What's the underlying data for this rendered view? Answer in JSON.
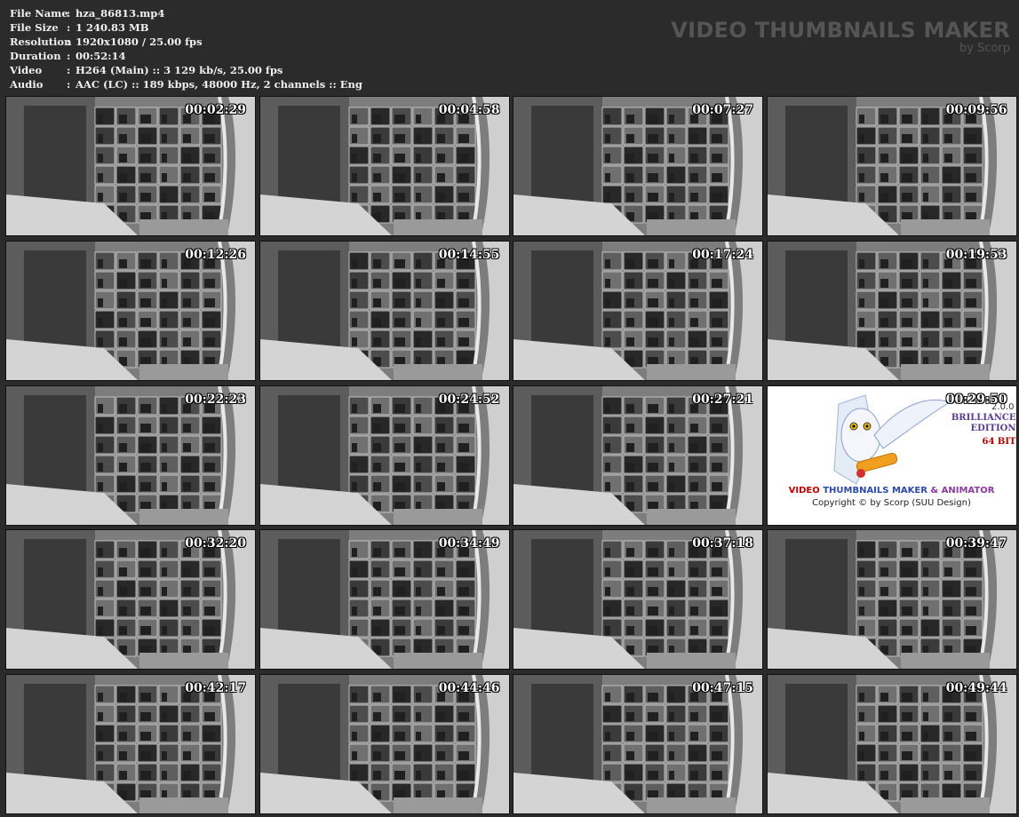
{
  "info": [
    {
      "label": "File Name",
      "sep": ":",
      "value": "hza_86813.mp4"
    },
    {
      "label": "File Size",
      "sep": ":",
      "value": "1 240.83 MB"
    },
    {
      "label": "Resolution",
      "sep": ":",
      "value": "1920x1080 / 25.00 fps"
    },
    {
      "label": "Duration",
      "sep": ":",
      "value": "00:52:14"
    },
    {
      "label": "Video",
      "sep": ":",
      "value": "H264 (Main) :: 3 129 kb/s, 25.00 fps"
    },
    {
      "label": "Audio",
      "sep": ":",
      "value": "AAC (LC) :: 189 kbps, 48000 Hz, 2 channels :: Eng"
    }
  ],
  "brand": {
    "title": "VIDEO THUMBNAILS MAKER",
    "subtitle": "by Scorp"
  },
  "thumbnails": [
    {
      "time": "00:02:29"
    },
    {
      "time": "00:04:58"
    },
    {
      "time": "00:07:27"
    },
    {
      "time": "00:09:56"
    },
    {
      "time": "00:12:26"
    },
    {
      "time": "00:14:55"
    },
    {
      "time": "00:17:24"
    },
    {
      "time": "00:19:53"
    },
    {
      "time": "00:22:23"
    },
    {
      "time": "00:24:52"
    },
    {
      "time": "00:27:21"
    },
    {
      "time": "00:29:50"
    },
    {
      "time": "00:32:20"
    },
    {
      "time": "00:34:49"
    },
    {
      "time": "00:37:18"
    },
    {
      "time": "00:39:47"
    },
    {
      "time": "00:42:17"
    },
    {
      "time": "00:44:46"
    },
    {
      "time": "00:47:15"
    },
    {
      "time": "00:49:44"
    }
  ],
  "logo_tile": {
    "version": "2.0.0",
    "edition_line1": "BRILLIANCE",
    "edition_line2": "EDITION",
    "edition_line3": "64 BIT",
    "title_part1": "VIDEO",
    "title_part2": "THUMBNAILS MAKER",
    "title_part3": "& ANIMATOR",
    "copyright": "Copyright © by Scorp (SUU Design)"
  },
  "colors": {
    "background": "#2b2b2b",
    "info_text": "#f0f0f0",
    "brand_text": "#555555",
    "timestamp": "#ffffff"
  }
}
